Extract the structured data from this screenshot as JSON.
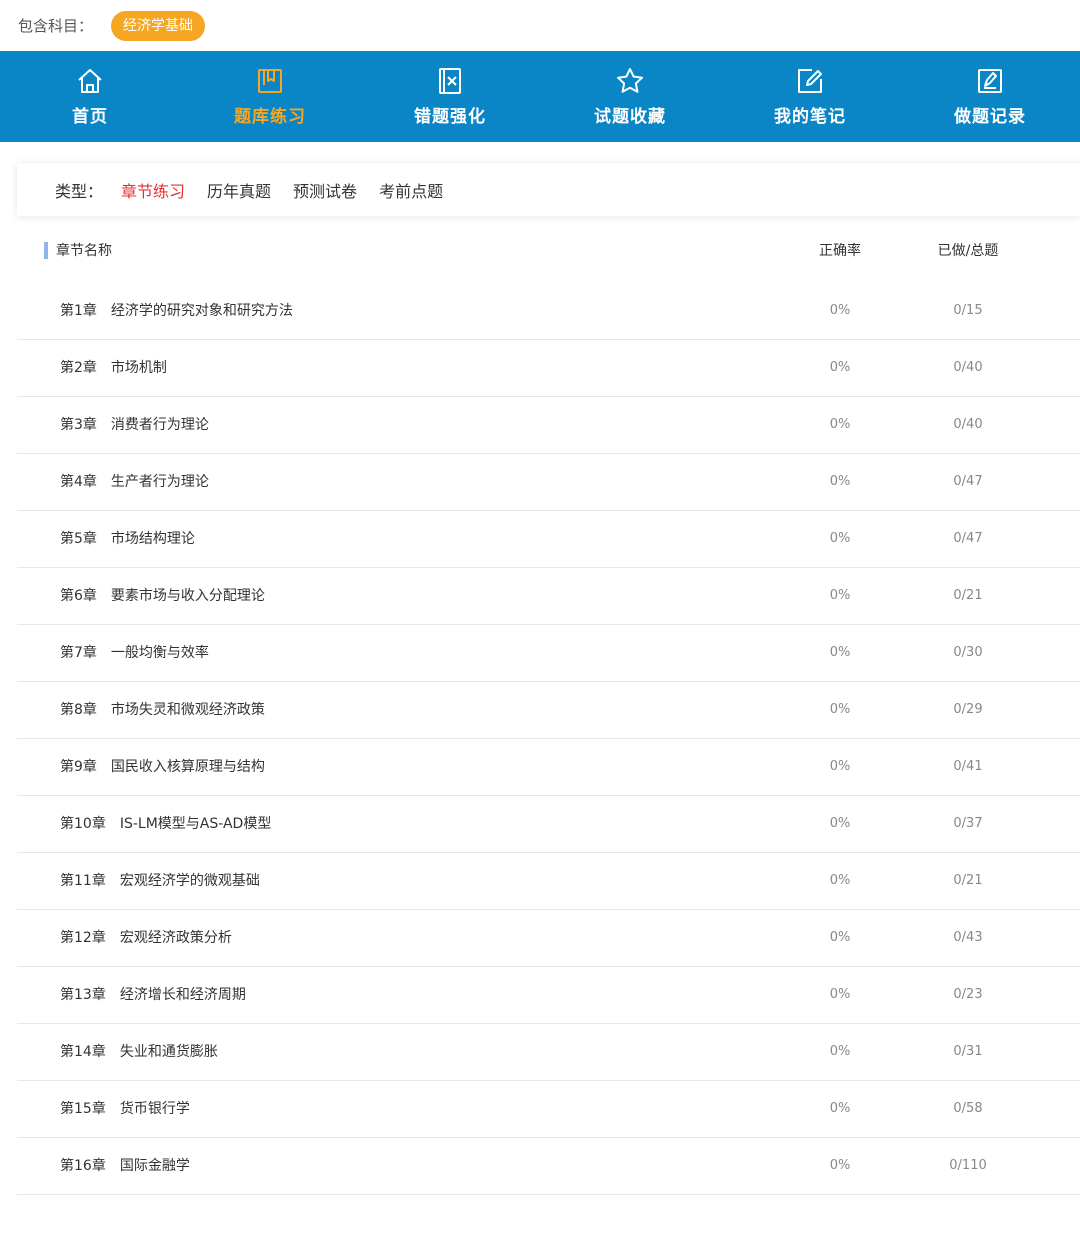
{
  "subject": {
    "label": "包含科目：",
    "chip": "经济学基础"
  },
  "nav": {
    "items": [
      {
        "label": "首页",
        "icon": "home-icon"
      },
      {
        "label": "题库练习",
        "icon": "book-icon"
      },
      {
        "label": "错题强化",
        "icon": "wrong-question-icon"
      },
      {
        "label": "试题收藏",
        "icon": "star-icon"
      },
      {
        "label": "我的笔记",
        "icon": "edit-note-icon"
      },
      {
        "label": "做题记录",
        "icon": "record-icon"
      }
    ],
    "active_index": 1,
    "colors": {
      "background": "#0a86c7",
      "active": "#f5a623",
      "text": "#ffffff"
    }
  },
  "types": {
    "label": "类型：",
    "tabs": [
      "章节练习",
      "历年真题",
      "预测试卷",
      "考前点题"
    ],
    "active_index": 0,
    "active_color": "#e5312f"
  },
  "table": {
    "headers": {
      "name": "章节名称",
      "rate": "正确率",
      "count": "已做/总题"
    },
    "rows": [
      {
        "chapter": "第1章",
        "name": "经济学的研究对象和研究方法",
        "rate": "0%",
        "count": "0/15"
      },
      {
        "chapter": "第2章",
        "name": "市场机制",
        "rate": "0%",
        "count": "0/40"
      },
      {
        "chapter": "第3章",
        "name": "消费者行为理论",
        "rate": "0%",
        "count": "0/40"
      },
      {
        "chapter": "第4章",
        "name": "生产者行为理论",
        "rate": "0%",
        "count": "0/47"
      },
      {
        "chapter": "第5章",
        "name": "市场结构理论",
        "rate": "0%",
        "count": "0/47"
      },
      {
        "chapter": "第6章",
        "name": "要素市场与收入分配理论",
        "rate": "0%",
        "count": "0/21"
      },
      {
        "chapter": "第7章",
        "name": "一般均衡与效率",
        "rate": "0%",
        "count": "0/30"
      },
      {
        "chapter": "第8章",
        "name": "市场失灵和微观经济政策",
        "rate": "0%",
        "count": "0/29"
      },
      {
        "chapter": "第9章",
        "name": "国民收入核算原理与结构",
        "rate": "0%",
        "count": "0/41"
      },
      {
        "chapter": "第10章",
        "name": "IS-LM模型与AS-AD模型",
        "rate": "0%",
        "count": "0/37"
      },
      {
        "chapter": "第11章",
        "name": "宏观经济学的微观基础",
        "rate": "0%",
        "count": "0/21"
      },
      {
        "chapter": "第12章",
        "name": "宏观经济政策分析",
        "rate": "0%",
        "count": "0/43"
      },
      {
        "chapter": "第13章",
        "name": "经济增长和经济周期",
        "rate": "0%",
        "count": "0/23"
      },
      {
        "chapter": "第14章",
        "name": "失业和通货膨胀",
        "rate": "0%",
        "count": "0/31"
      },
      {
        "chapter": "第15章",
        "name": "货币银行学",
        "rate": "0%",
        "count": "0/58"
      },
      {
        "chapter": "第16章",
        "name": "国际金融学",
        "rate": "0%",
        "count": "0/110"
      }
    ]
  }
}
